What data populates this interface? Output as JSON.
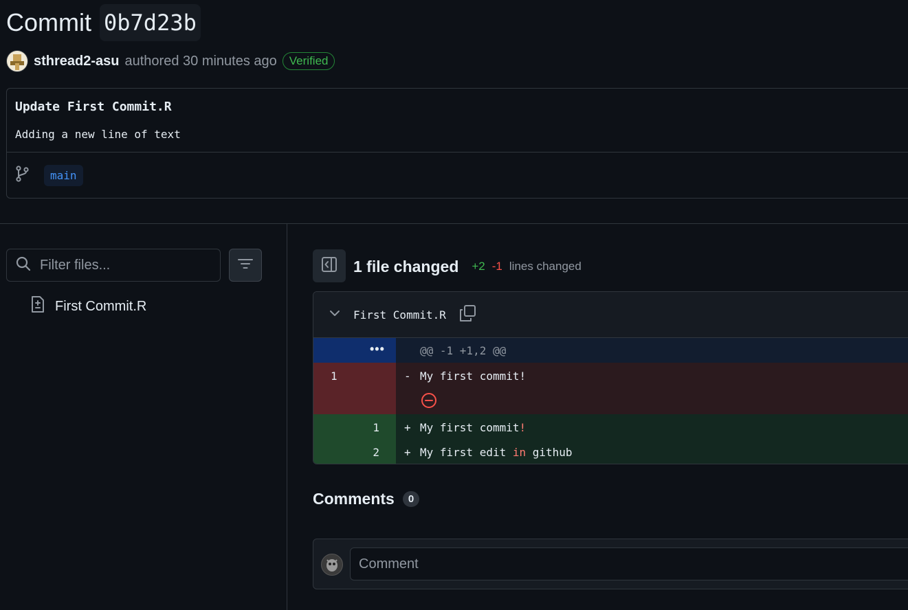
{
  "commit": {
    "title_prefix": "Commit",
    "sha": "0b7d23b",
    "author": "sthread2-asu",
    "authored_text": "authored 30 minutes ago",
    "verified_label": "Verified"
  },
  "message": {
    "title": "Update First Commit.R",
    "body": "Adding a new line of text",
    "branch": "main"
  },
  "sidebar": {
    "filter_placeholder": "Filter files...",
    "files": [
      "First Commit.R"
    ]
  },
  "summary": {
    "files_changed": "1 file changed",
    "additions": "+2",
    "deletions": "-1",
    "lines_label": "lines changed"
  },
  "diff": {
    "filename": "First Commit.R",
    "hunk_expand": "•••",
    "hunk_header": "@@ -1 +1,2 @@",
    "rows": [
      {
        "type": "del",
        "old": "1",
        "new": "",
        "sign": "-",
        "code": "My first commit!"
      },
      {
        "type": "add",
        "old": "",
        "new": "1",
        "sign": "+",
        "code_a": "My first commit",
        "code_b": "!"
      },
      {
        "type": "add",
        "old": "",
        "new": "2",
        "sign": "+",
        "code_a": "My first edit ",
        "code_b": "in",
        "code_c": " github"
      }
    ]
  },
  "comments": {
    "title": "Comments",
    "count": "0",
    "placeholder": "Comment"
  },
  "colors": {
    "background": "#0d1117",
    "added": "#3fb950",
    "deleted": "#f85149",
    "link": "#4493f8"
  }
}
